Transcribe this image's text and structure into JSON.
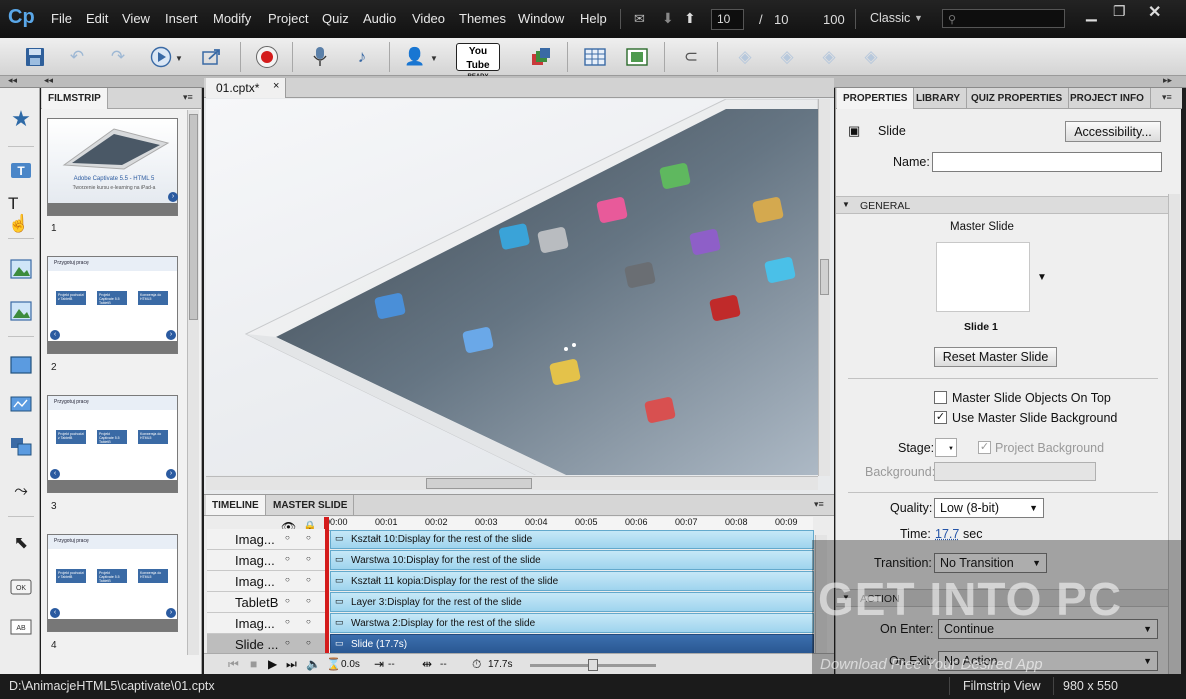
{
  "app": {
    "logo": "Cp"
  },
  "menu": [
    "File",
    "Edit",
    "View",
    "Insert",
    "Modify",
    "Project",
    "Quiz",
    "Audio",
    "Video",
    "Themes",
    "Window",
    "Help"
  ],
  "nav": {
    "current_slide": "10",
    "separator": "/",
    "total_slides": "10",
    "zoom": "100",
    "workspace": "Classic"
  },
  "toolbar_icons": [
    "save-icon",
    "undo-icon",
    "redo-icon",
    "play-icon",
    "publish-icon",
    "record-icon",
    "microphone-icon",
    "audio-icon",
    "user-icon",
    "youtube-icon",
    "theme-icon",
    "table-icon",
    "filmstrip-grid-icon",
    "magnet-icon",
    "layer-icons"
  ],
  "youtube": {
    "top": "You Tube",
    "bottom": "READY"
  },
  "filmstrip": {
    "tab": "FILMSTRIP",
    "slides": [
      {
        "num": "1",
        "title": "Adobe Captivate 5.5 - HTML 5",
        "subtitle": "Tworzenie kursu e-learning na iPad-a"
      },
      {
        "num": "2",
        "title": "Przygotuj pracę",
        "boxes": [
          "Projekt pochodzi z TabletB",
          "Projekt Captivate 5.5 TabletB",
          "Konwersja do HTML5"
        ]
      },
      {
        "num": "3",
        "title": "Przygotuj pracę",
        "boxes": [
          "Projekt pochodzi z TabletB",
          "Projekt Captivate 5.5 TabletB",
          "Konwersja do HTML5"
        ]
      },
      {
        "num": "4",
        "title": "Przygotuj pracę",
        "boxes": [
          "Projekt pochodzi z TabletB",
          "Projekt Captivate 5.5 TabletB",
          "Konwersja do HTML5"
        ]
      }
    ]
  },
  "document": {
    "tab": "01.cptx*",
    "close": "×"
  },
  "timeline": {
    "tabs": [
      "TIMELINE",
      "MASTER SLIDE"
    ],
    "ticks": [
      "00:00",
      "00:01",
      "00:02",
      "00:03",
      "00:04",
      "00:05",
      "00:06",
      "00:07",
      "00:08",
      "00:09"
    ],
    "rows": [
      {
        "name": "Imag...",
        "bar": "Kształt 10:Display for the rest of the slide"
      },
      {
        "name": "Imag...",
        "bar": "Warstwa 10:Display for the rest of the slide"
      },
      {
        "name": "Imag...",
        "bar": "Kształt 11 kopia:Display for the rest of the slide"
      },
      {
        "name": "TabletB",
        "bar": "Layer 3:Display for the rest of the slide"
      },
      {
        "name": "Imag...",
        "bar": "Warstwa 2:Display for the rest of the slide"
      },
      {
        "name": "Slide ...",
        "bar": "Slide (17.7s)"
      }
    ],
    "footer": {
      "time1": "0.0s",
      "time2": "--",
      "time3": "--",
      "duration": "17.7s"
    }
  },
  "properties": {
    "tabs": [
      "PROPERTIES",
      "LIBRARY",
      "QUIZ PROPERTIES",
      "PROJECT INFO"
    ],
    "type_label": "Slide",
    "accessibility": "Accessibility...",
    "name_label": "Name:",
    "name_value": "",
    "general": "GENERAL",
    "master_slide_label": "Master Slide",
    "master_slide_name": "Slide 1",
    "reset_btn": "Reset Master Slide",
    "cb_master_objects": "Master Slide Objects On Top",
    "cb_master_objects_checked": false,
    "cb_use_bg": "Use Master Slide Background",
    "cb_use_bg_checked": true,
    "stage_label": "Stage:",
    "project_bg": "Project Background",
    "background_label": "Background:",
    "quality_label": "Quality:",
    "quality_value": "Low (8-bit)",
    "time_label": "Time:",
    "time_value": "17.7",
    "time_unit": "sec",
    "transition_label": "Transition:",
    "transition_value": "No Transition",
    "action": "ACTION",
    "on_enter_label": "On Enter:",
    "on_enter_value": "Continue",
    "on_exit_label": "On Exit:",
    "on_exit_value": "No Action"
  },
  "status": {
    "path": "D:\\AnimacjeHTML5\\captivate\\01.cptx",
    "view": "Filmstrip View",
    "size": "980 x 550"
  },
  "watermark": {
    "main": "GET INTO PC",
    "sub": "Download Free Your Desired App"
  },
  "colors": {
    "accent": "#2a5792",
    "timeline_bar": "#9fd4ee",
    "record": "#d41c1c",
    "menubar": "#1a1a1a"
  }
}
